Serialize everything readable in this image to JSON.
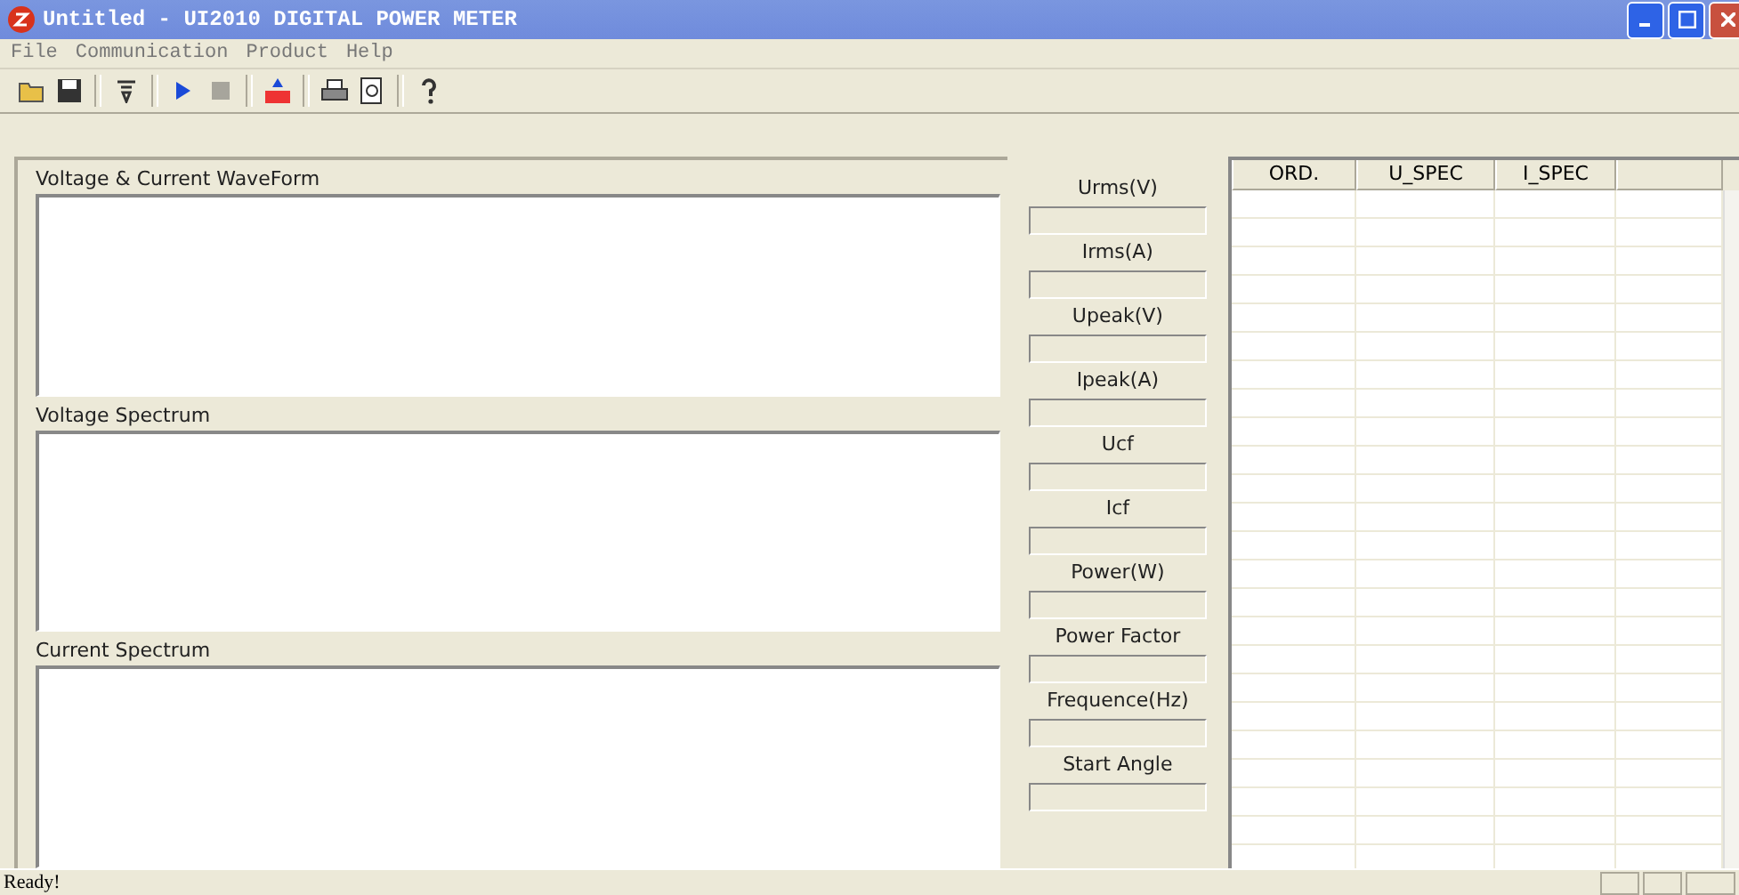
{
  "window": {
    "title": "Untitled - UI2010 DIGITAL POWER METER"
  },
  "menu": [
    "File",
    "Communication",
    "Product",
    "Help"
  ],
  "toolbar": [
    {
      "kind": "open",
      "disabled": false
    },
    {
      "kind": "save",
      "disabled": false
    },
    {
      "kind": "sep"
    },
    {
      "kind": "filter",
      "disabled": false
    },
    {
      "kind": "sep"
    },
    {
      "kind": "play",
      "disabled": false
    },
    {
      "kind": "stop",
      "disabled": true
    },
    {
      "kind": "sep"
    },
    {
      "kind": "number",
      "disabled": false
    },
    {
      "kind": "sep"
    },
    {
      "kind": "print",
      "disabled": false
    },
    {
      "kind": "preview",
      "disabled": false
    },
    {
      "kind": "sep"
    },
    {
      "kind": "help",
      "disabled": false
    }
  ],
  "plots": [
    "Voltage & Current WaveForm",
    "Voltage Spectrum",
    "Current Spectrum"
  ],
  "readings": [
    "Urms(V)",
    "Irms(A)",
    "Upeak(V)",
    "Ipeak(A)",
    "Ucf",
    "Icf",
    "Power(W)",
    "Power Factor",
    "Frequence(Hz)",
    "Start Angle"
  ],
  "table": {
    "columns": [
      "ORD.",
      "U_SPEC",
      "I_SPEC"
    ]
  },
  "status_bar": {
    "text": "Ready!"
  }
}
